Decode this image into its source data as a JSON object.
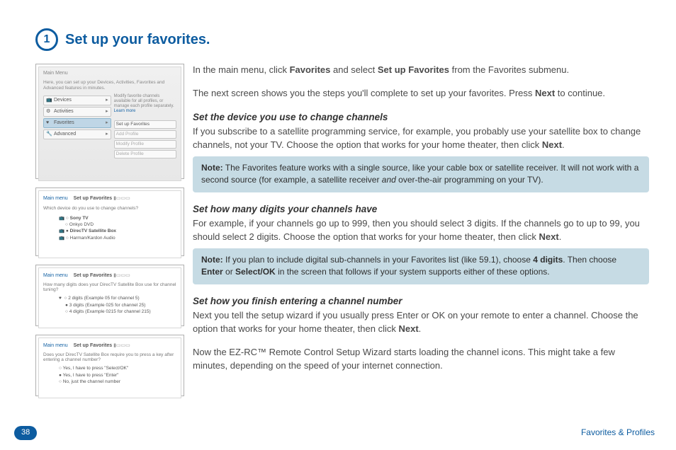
{
  "step_number": "1",
  "heading": "Set up your favorites.",
  "screenshots": {
    "s1": {
      "title": "Main Menu",
      "intro": "Here, you can set up your Devices, Activities, Favorites and Advanced features in minutes.",
      "devices": "Devices",
      "activities": "Activities",
      "favorites": "Favorites",
      "advanced": "Advanced",
      "side_text": "Modify favorite channels available for all profiles, or manage each profile separately.",
      "learn_more": "Learn more",
      "btn_setup": "Set up Favorites",
      "btn_add": "Add Profile",
      "btn_mod": "Modify Profile",
      "btn_del": "Delete Profile"
    },
    "s2": {
      "mm": "Main menu",
      "cur": "Set up Favorites",
      "q": "Which device do you use to change channels?",
      "o1": "Sony TV",
      "o2": "Onkyo DVD",
      "o3": "DirecTV Satellite Box",
      "o4": "Harman/Kardon Audio"
    },
    "s3": {
      "mm": "Main menu",
      "cur": "Set up Favorites",
      "q": "How many digits does your DirecTV Satellite Box use for channel tuning?",
      "o1": "2 digits (Example 05 for channel 5)",
      "o2": "3 digits (Example 025 for channel 25)",
      "o3": "4 digits (Example 0215 for channel 215)"
    },
    "s4": {
      "mm": "Main menu",
      "cur": "Set up Favorites",
      "q": "Does your DirecTV Satellite Box require you to press a key after entering a channel number?",
      "o1": "Yes, I have to press \"Select/OK\"",
      "o2": "Yes, I have to press \"Enter\"",
      "o3": "No, just the channel number"
    }
  },
  "body": {
    "p1a": "In the main menu, click ",
    "p1b": "Favorites",
    "p1c": " and select ",
    "p1d": "Set up Favorites",
    "p1e": " from the Favorites submenu.",
    "p2a": "The next screen shows you the steps you'll complete to set up your favorites. Press ",
    "p2b": "Next",
    "p2c": " to continue.",
    "h1": "Set the device you use to change channels",
    "p3a": "If you subscribe to a satellite programming service, for example, you probably use your satellite box to change channels, not your TV. Choose the option that works for your home theater, then click ",
    "p3b": "Next",
    "p3c": ".",
    "note1a": "Note:",
    "note1b": " The Favorites feature works with a single source, like your cable box or satellite receiver. It will not work with a second source (for example, a satellite receiver ",
    "note1c": "and",
    "note1d": " over-the-air programming on your TV).",
    "h2": "Set how many digits your channels have",
    "p4a": "For example, if your channels go up to 999, then you should select 3 digits. If the channels go to up to 99, you should select 2 digits. Choose the option that works for your home theater, then click ",
    "p4b": "Next",
    "p4c": ".",
    "note2a": "Note:",
    "note2b": " If you plan to include digital sub-channels in your Favorites list (like 59.1), choose ",
    "note2c": "4 digits",
    "note2d": ". Then choose ",
    "note2e": "Enter",
    "note2f": " or ",
    "note2g": "Select/OK",
    "note2h": " in the screen that follows if your system supports either of these options.",
    "h3": "Set how you finish entering a channel number",
    "p5a": "Next you tell the setup wizard if you usually press Enter or OK on your remote to enter a channel. Choose the option that works for your home theater, then click ",
    "p5b": "Next",
    "p5c": ".",
    "p6": "Now the EZ-RC™ Remote Control Setup Wizard starts loading the channel icons. This might take a few minutes, depending on the speed of your internet connection."
  },
  "footer": {
    "page": "38",
    "section": "Favorites & Profiles"
  }
}
